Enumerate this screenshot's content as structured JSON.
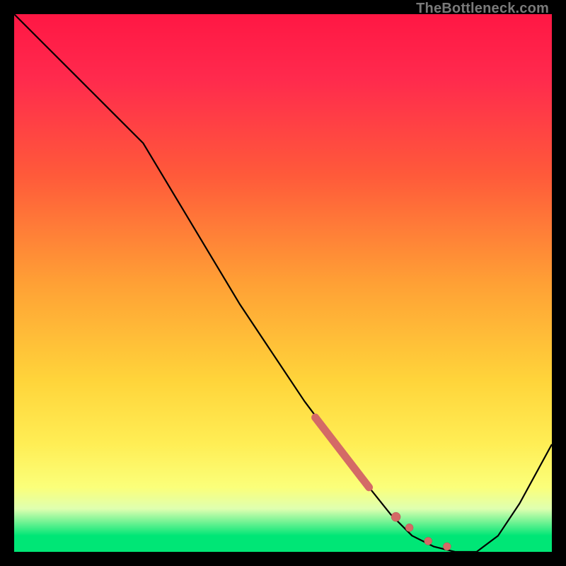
{
  "watermark": "TheBottleneck.com",
  "colors": {
    "curve": "#000000",
    "dots": "#d46a66",
    "dots_outline": "#b35550",
    "gradient_top": "#ff1744",
    "gradient_bottom": "#00e676"
  },
  "chart_data": {
    "type": "line",
    "title": "",
    "xlabel": "",
    "ylabel": "",
    "xlim": [
      0,
      100
    ],
    "ylim": [
      0,
      100
    ],
    "grid": false,
    "legend": false,
    "series": [
      {
        "name": "bottleneck-curve",
        "x": [
          0,
          6,
          12,
          18,
          24,
          30,
          36,
          42,
          48,
          54,
          60,
          66,
          70,
          74,
          78,
          82,
          86,
          90,
          94,
          100
        ],
        "y": [
          100,
          94,
          88,
          82,
          76,
          66,
          56,
          46,
          37,
          28,
          20,
          12,
          7,
          3,
          1,
          0,
          0,
          3,
          9,
          20
        ]
      }
    ],
    "highlight_segment": {
      "name": "thick-red-segment",
      "x": [
        56,
        66
      ],
      "y": [
        25,
        12
      ]
    },
    "highlight_dots": {
      "name": "red-dots",
      "points": [
        {
          "x": 71,
          "y": 6.5
        },
        {
          "x": 73.5,
          "y": 4.5
        },
        {
          "x": 77,
          "y": 2
        },
        {
          "x": 80.5,
          "y": 1
        }
      ]
    }
  }
}
